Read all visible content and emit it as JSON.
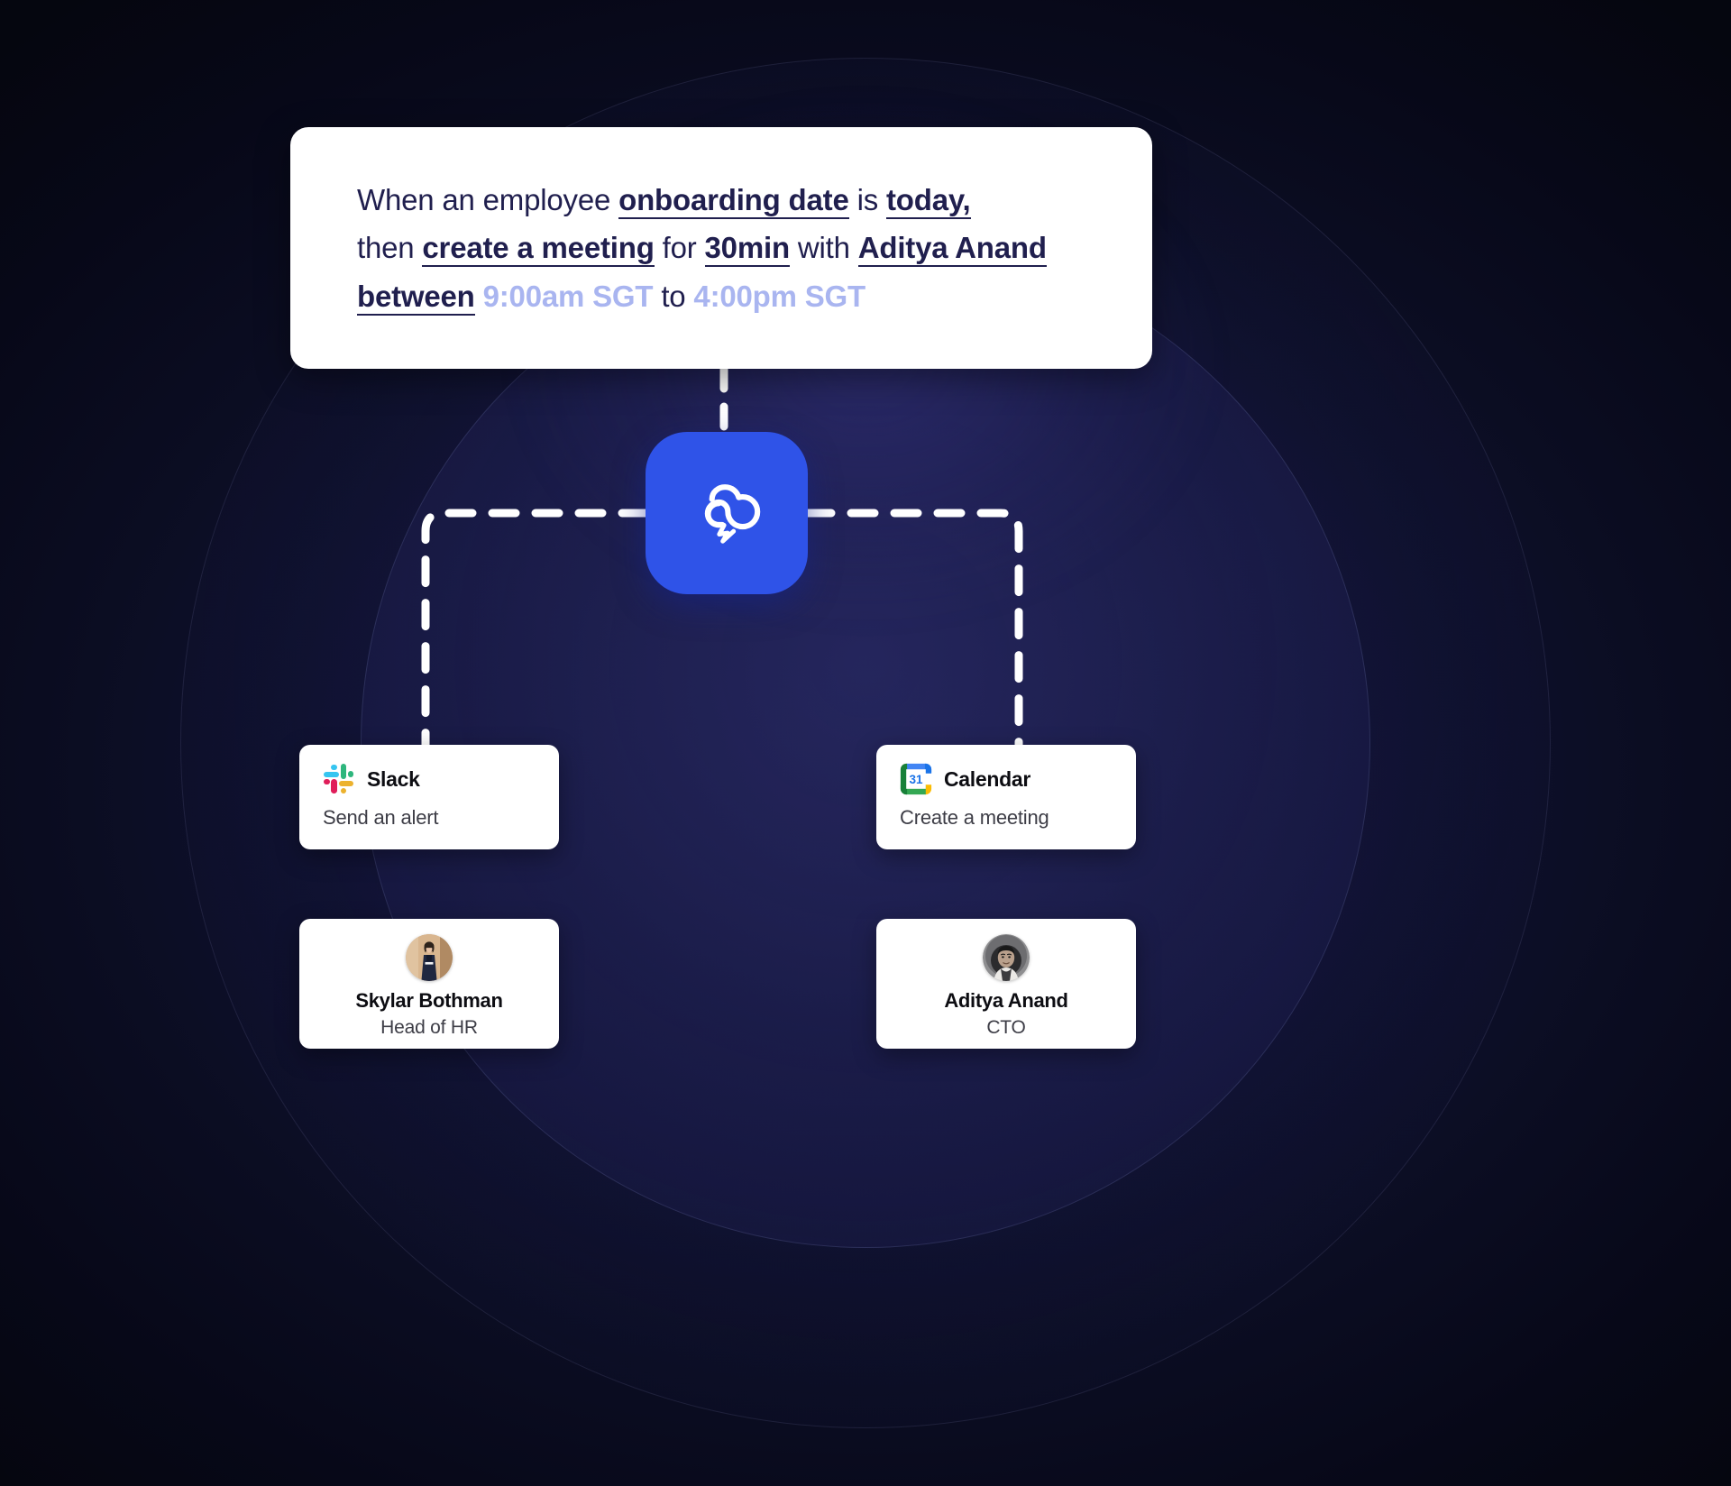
{
  "theme": {
    "background_dark": "#0b0d22",
    "accent_blue": "#2f53e8",
    "card_white": "#ffffff",
    "rule_text_navy": "#201f4e",
    "time_chip_blue": "#a9b5f0"
  },
  "rule": {
    "segments": [
      {
        "text": "When an employee ",
        "style": "plain"
      },
      {
        "text": "onboarding date",
        "style": "chip"
      },
      {
        "text": " is ",
        "style": "plain"
      },
      {
        "text": "today,",
        "style": "chip"
      },
      {
        "text": "then ",
        "style": "plain"
      },
      {
        "text": "create a meeting",
        "style": "chip"
      },
      {
        "text": " for ",
        "style": "plain"
      },
      {
        "text": "30min",
        "style": "chip"
      },
      {
        "text": " with ",
        "style": "plain"
      },
      {
        "text": "Aditya Anand",
        "style": "chip"
      },
      {
        "text": "between",
        "style": "chip"
      },
      {
        "text": " 9:00am SGT",
        "style": "time"
      },
      {
        "text": " to ",
        "style": "plain"
      },
      {
        "text": "4:00pm SGT",
        "style": "time"
      }
    ],
    "line1_pre": "When an employee ",
    "line1_chip1": "onboarding date",
    "line1_mid": " is ",
    "line1_chip2": "today,",
    "line2_pre": "then ",
    "line2_chip1": "create a meeting",
    "line2_mid1": "  for ",
    "line2_chip2": "30min",
    "line2_mid2": " with ",
    "line2_chip3": "Aditya Anand",
    "line3_chip1": "between",
    "line3_time1": " 9:00am SGT",
    "line3_mid": " to ",
    "line3_time2": "4:00pm SGT"
  },
  "hub": {
    "icon": "cloud-lightning-icon",
    "label": "automation-hub"
  },
  "actions": [
    {
      "icon": "slack-icon",
      "title": "Slack",
      "subtitle": "Send an alert"
    },
    {
      "icon": "google-calendar-icon",
      "title": "Calendar",
      "subtitle": "Create a meeting"
    }
  ],
  "people": [
    {
      "avatar": "avatar-skylar-bothman",
      "name": "Skylar Bothman",
      "role": "Head of HR"
    },
    {
      "avatar": "avatar-aditya-anand",
      "name": "Aditya Anand",
      "role": "CTO"
    }
  ]
}
